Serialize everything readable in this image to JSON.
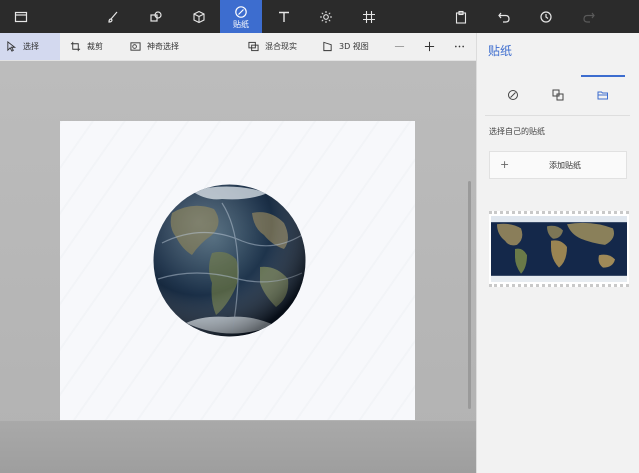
{
  "toolbar": {
    "active_tool_label": "贴纸",
    "tools": [
      "menu",
      "brushes",
      "2d-shapes",
      "3d-shapes",
      "stickers",
      "text",
      "effects",
      "canvas",
      "paste",
      "undo",
      "history",
      "redo"
    ]
  },
  "subbar": {
    "select_label": "选择",
    "crop_label": "裁剪",
    "magic_select_label": "神奇选择",
    "mixed_reality_label": "混合现实",
    "view3d_label": "3D 视图"
  },
  "panel": {
    "title": "贴纸",
    "caption": "选择自己的贴纸",
    "add_label": "添加贴纸",
    "add_icon": "+"
  },
  "colors": {
    "accent": "#3d6dcf",
    "toolbar_bg": "#2b2b2b",
    "panel_bg": "#f2f2f2"
  }
}
